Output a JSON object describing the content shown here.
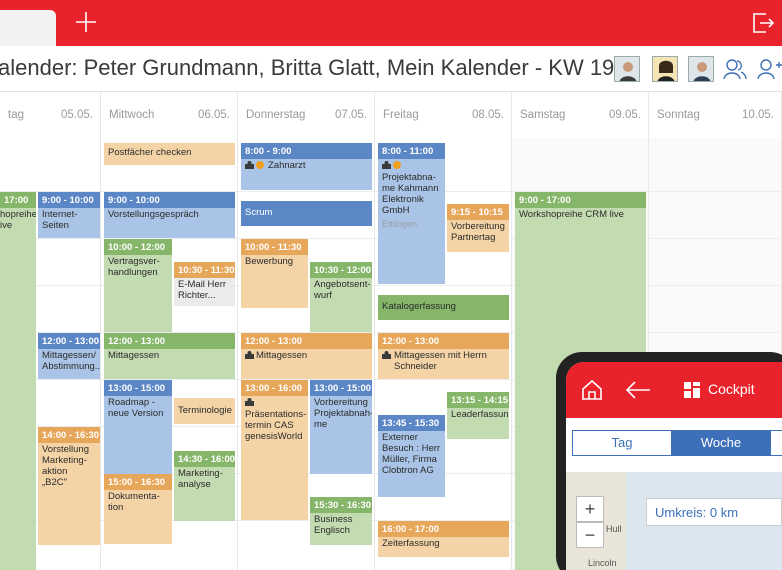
{
  "title": "alender: Peter Grundmann, Britta Glatt, Mein Kalender - KW 19",
  "colors": {
    "brand": "#e8232c",
    "blue": "#5c87c7",
    "green": "#86b66a",
    "orange": "#e7a75b"
  },
  "days": [
    {
      "name": "tag",
      "date": "05.05."
    },
    {
      "name": "Mittwoch",
      "date": "06.05."
    },
    {
      "name": "Donnerstag",
      "date": "07.05."
    },
    {
      "name": "Freitag",
      "date": "08.05."
    },
    {
      "name": "Samstag",
      "date": "09.05."
    },
    {
      "name": "Sonntag",
      "date": "10.05."
    }
  ],
  "events": {
    "tue_workshop_time": "17:00",
    "tue_workshop_text": "hopreihe\nive",
    "tue_internet_time": "9:00 - 10:00",
    "tue_internet_text": "Internet-\nSeiten",
    "tue_lunch_time": "12:00 - 13:00",
    "tue_lunch_text": "Mittagessen/\nAbstimmung...",
    "tue_marketing_time": "14:00 - 16:30",
    "tue_marketing_text": "Vorstellung\nMarketing-\naktion\n„B2C\"",
    "wed_postfach_text": "Postfächer checken",
    "wed_vorstellung_time": "9:00 - 10:00",
    "wed_vorstellung_text": "Vorstellungsgespräch",
    "wed_vertrag_time": "10:00 - 12:00",
    "wed_vertrag_text": "Vertragsver-\nhandlungen",
    "wed_email_time": "10:30 - 11:30",
    "wed_email_text": "E-Mail Herr\nRichter...",
    "wed_lunch_time": "12:00 - 13:00",
    "wed_lunch_text": "Mittagessen",
    "wed_roadmap_time": "13:00 - 15:00",
    "wed_roadmap_text": "Roadmap -\nneue Version",
    "wed_term_text": "Terminologie",
    "wed_mark_time": "14:30 - 16:00",
    "wed_mark_text": "Marketing-\nanalyse",
    "wed_doku_time": "15:00 - 16:30",
    "wed_doku_text": "Dokumenta-\ntion",
    "thu_zahn_time": "8:00 - 9:00",
    "thu_zahn_text": "Zahnarzt",
    "thu_scrum_text": "Scrum",
    "thu_bewerb_time": "10:00 - 11:30",
    "thu_bewerb_text": "Bewerbung",
    "thu_angebot_time": "10:30 - 12:00",
    "thu_angebot_text": "Angebotsent-\nwurf",
    "thu_lunch_time": "12:00 - 13:00",
    "thu_lunch_text": "Mittagessen",
    "thu_praes_time": "13:00 - 16:00",
    "thu_praes_text": "Präsentations-\ntermin CAS\ngenesisWorld",
    "thu_vorb_time": "13:00 - 15:00",
    "thu_vorb_text": "Vorbereitung\nProjektabnah-\nme",
    "thu_engl_time": "15:30 - 16:30",
    "thu_engl_text": "Business\nEnglisch",
    "fri_proj_time": "8:00 - 11:00",
    "fri_proj_text": "Projektabna-\nme Kahmann\nElektronik\nGmbH",
    "fri_proj_loc": "Ettlingen",
    "fri_partner_time": "9:15 - 10:15",
    "fri_partner_text": "Vorbereitung\nPartnertag",
    "fri_katalog_text": "Katalogerfassung",
    "fri_lunch_time": "12:00 - 13:00",
    "fri_lunch_text": "Mittagessen mit Herrn\nSchneider",
    "fri_leader_time": "13:15 - 14:15",
    "fri_leader_text": "Leaderfassung",
    "fri_extern_time": "13:45 - 15:30",
    "fri_extern_text": "Externer\nBesuch : Herr\nMüller, Firma\nClobtron AG",
    "fri_zeit_time": "16:00 - 17:00",
    "fri_zeit_text": "Zeiterfassung",
    "sat_workshop_time": "9:00 - 17:00",
    "sat_workshop_text": "Workshopreihe CRM live"
  },
  "phone": {
    "cockpit": "Cockpit",
    "tabs": [
      "Tag",
      "Woche"
    ],
    "active_tab": "Woche",
    "umkreis": "Umkreis: 0 km",
    "zoom_in": "+",
    "zoom_out": "−",
    "map_labels": [
      "Hull",
      "Lincoln"
    ]
  }
}
